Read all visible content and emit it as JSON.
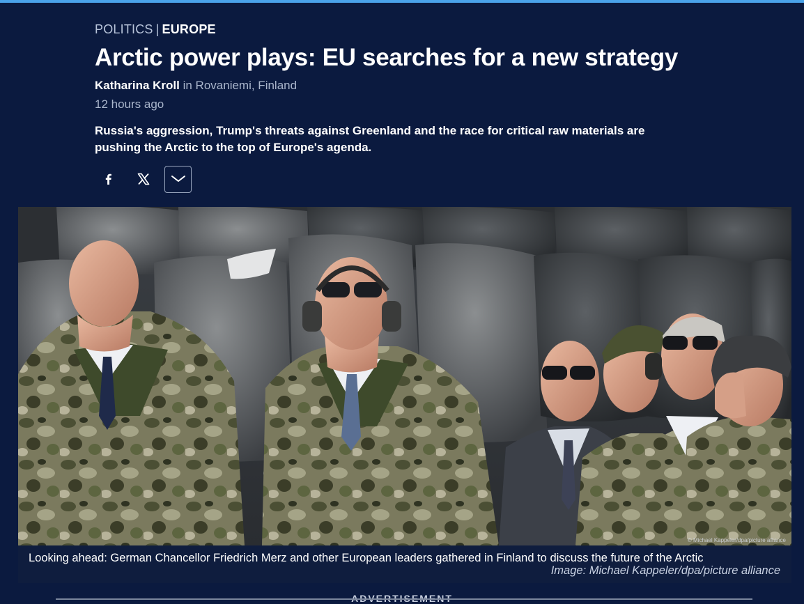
{
  "kicker": {
    "section": "POLITICS",
    "separator": "|",
    "subsection": "EUROPE"
  },
  "article": {
    "title": "Arctic power plays: EU searches for a new strategy",
    "author": "Katharina Kroll",
    "location": "in Rovaniemi, Finland",
    "time": "12 hours ago",
    "teaser": "Russia's aggression, Trump's threats against Greenland and the race for critical raw materials are pushing the Arctic to the top of Europe's agenda."
  },
  "share": {
    "icons": [
      "facebook-icon",
      "x-icon",
      "chevron-down-icon"
    ]
  },
  "figure": {
    "photo_credit_overlay": "© Michael Kappeler/dpa/picture alliance",
    "caption": "Looking ahead: German Chancellor Friedrich Merz and other European leaders gathered in Finland to discuss the future of the Arctic",
    "credit": "Image: Michael Kappeler/dpa/picture alliance"
  },
  "ad": {
    "label": "ADVERTISEMENT"
  },
  "colors": {
    "background": "#0b1a3f",
    "accent": "#4aa3ea"
  }
}
